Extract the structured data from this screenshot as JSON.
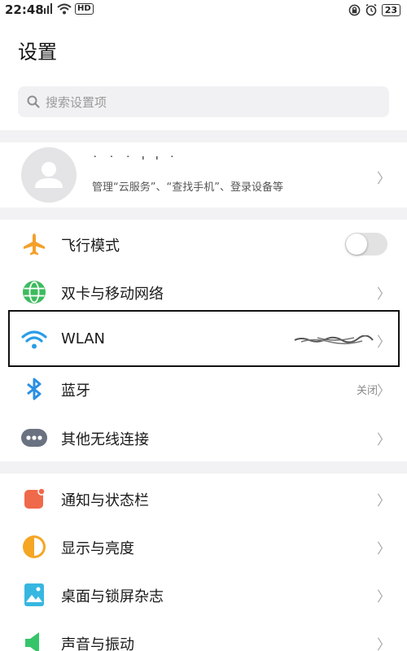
{
  "status_bar": {
    "time": "22:48",
    "hd_label": "HD",
    "battery": "23"
  },
  "header": {
    "title": "设置"
  },
  "search": {
    "placeholder": "搜索设置项"
  },
  "account": {
    "name": "˙ ˙ ˙   ' ' ˙",
    "description": "管理“云服务”、“查找手机”、登录设备等"
  },
  "network_section": [
    {
      "id": "airplane",
      "label": "飞行模式",
      "icon": "airplane-icon",
      "control": "toggle",
      "toggle_on": false
    },
    {
      "id": "dual-sim",
      "label": "双卡与移动网络",
      "icon": "globe-icon",
      "control": "chevron"
    },
    {
      "id": "wlan",
      "label": "WLAN",
      "icon": "wifi-icon",
      "control": "chevron",
      "highlighted": true
    },
    {
      "id": "bluetooth",
      "label": "蓝牙",
      "icon": "bluetooth-icon",
      "control": "chevron",
      "value": "关闭"
    },
    {
      "id": "other-wireless",
      "label": "其他无线连接",
      "icon": "more-icon",
      "control": "chevron"
    }
  ],
  "display_section": [
    {
      "id": "notifications",
      "label": "通知与状态栏",
      "icon": "notification-icon",
      "control": "chevron"
    },
    {
      "id": "display",
      "label": "显示与亮度",
      "icon": "brightness-icon",
      "control": "chevron"
    },
    {
      "id": "wallpaper",
      "label": "桌面与锁屏杂志",
      "icon": "wallpaper-icon",
      "control": "chevron"
    },
    {
      "id": "sound",
      "label": "声音与振动",
      "icon": "sound-icon",
      "control": "chevron"
    }
  ],
  "chevron_glyph": "〉",
  "colors": {
    "airplane": "#f4a02a",
    "globe": "#3dbb5e",
    "wifi": "#2a9de8",
    "bluetooth": "#2a8fe2",
    "more": "#6a7282",
    "notification": "#ef6a4a",
    "brightness": "#f5a623",
    "wallpaper": "#37b7e0",
    "sound": "#36c46a"
  }
}
